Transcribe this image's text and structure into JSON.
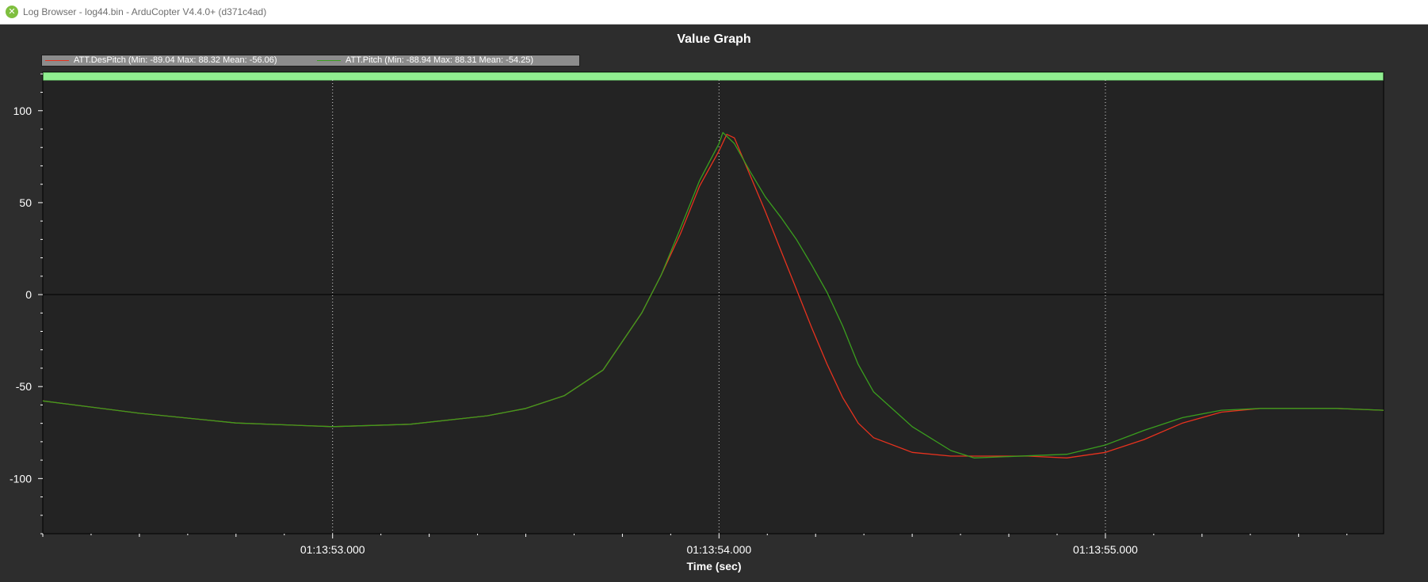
{
  "window": {
    "title": "Log Browser - log44.bin - ArduCopter V4.4.0+ (d371c4ad)"
  },
  "colors": {
    "series_despitch": "#e8321e",
    "series_pitch": "#3a9e1e",
    "plot_background": "#232323",
    "frame_background": "#2d2d2d",
    "mode_band": "#90ee90",
    "legend_background": "#8c8c8c"
  },
  "chart_data": {
    "type": "line",
    "title": "Value Graph",
    "xlabel": "Time (sec)",
    "ylabel": "",
    "x_units": "seconds (time of day)",
    "xlim": [
      "01:13:52.250",
      "01:13:55.720"
    ],
    "ylim": [
      -130,
      121
    ],
    "x_ticks": [
      "01:13:53.000",
      "01:13:54.000",
      "01:13:55.000"
    ],
    "y_ticks": [
      100,
      50,
      0,
      -50,
      -100
    ],
    "grid": "vertical dotted lines at major x ticks",
    "legend": "top-left",
    "top_band": "green bar across top of plot",
    "series": [
      {
        "name": "ATT.DesPitch",
        "legend_label": "ATT.DesPitch  (Min: -89.04 Max: 88.32 Mean: -56.06)",
        "color": "#e8321e",
        "points": [
          [
            "01:13:52.250",
            -57.8
          ],
          [
            "01:13:52.500",
            -64.5
          ],
          [
            "01:13:52.750",
            -69.8
          ],
          [
            "01:13:53.000",
            -71.8
          ],
          [
            "01:13:53.200",
            -70.5
          ],
          [
            "01:13:53.400",
            -65.9
          ],
          [
            "01:13:53.500",
            -61.9
          ],
          [
            "01:13:53.600",
            -54.9
          ],
          [
            "01:13:53.700",
            -41.0
          ],
          [
            "01:13:53.800",
            -10.0
          ],
          [
            "01:13:53.850",
            10.5
          ],
          [
            "01:13:53.900",
            33.0
          ],
          [
            "01:13:53.950",
            59.1
          ],
          [
            "01:13:54.000",
            78.1
          ],
          [
            "01:13:54.020",
            87.1
          ],
          [
            "01:13:54.040",
            85.2
          ],
          [
            "01:13:54.080",
            65.1
          ],
          [
            "01:13:54.120",
            45.2
          ],
          [
            "01:13:54.160",
            24.1
          ],
          [
            "01:13:54.200",
            3.1
          ],
          [
            "01:13:54.240",
            -18.0
          ],
          [
            "01:13:54.280",
            -37.9
          ],
          [
            "01:13:54.320",
            -55.9
          ],
          [
            "01:13:54.360",
            -69.8
          ],
          [
            "01:13:54.400",
            -77.8
          ],
          [
            "01:13:54.500",
            -85.8
          ],
          [
            "01:13:54.600",
            -87.8
          ],
          [
            "01:13:54.800",
            -87.8
          ],
          [
            "01:13:54.900",
            -88.8
          ],
          [
            "01:13:55.000",
            -85.8
          ],
          [
            "01:13:55.100",
            -78.8
          ],
          [
            "01:13:55.200",
            -69.8
          ],
          [
            "01:13:55.300",
            -63.9
          ],
          [
            "01:13:55.400",
            -61.9
          ],
          [
            "01:13:55.600",
            -61.9
          ],
          [
            "01:13:55.720",
            -62.9
          ]
        ]
      },
      {
        "name": "ATT.Pitch",
        "legend_label": "ATT.Pitch  (Min: -88.94 Max: 88.31 Mean: -54.25)",
        "color": "#3a9e1e",
        "points": [
          [
            "01:13:52.250",
            -57.8
          ],
          [
            "01:13:52.500",
            -64.5
          ],
          [
            "01:13:52.750",
            -69.8
          ],
          [
            "01:13:53.000",
            -71.8
          ],
          [
            "01:13:53.200",
            -70.5
          ],
          [
            "01:13:53.400",
            -65.9
          ],
          [
            "01:13:53.500",
            -61.9
          ],
          [
            "01:13:53.600",
            -54.9
          ],
          [
            "01:13:53.700",
            -41.0
          ],
          [
            "01:13:53.800",
            -10.0
          ],
          [
            "01:13:53.850",
            10.5
          ],
          [
            "01:13:53.900",
            36.0
          ],
          [
            "01:13:53.950",
            62.1
          ],
          [
            "01:13:54.000",
            82.1
          ],
          [
            "01:13:54.010",
            88.1
          ],
          [
            "01:13:54.040",
            82.1
          ],
          [
            "01:13:54.080",
            67.1
          ],
          [
            "01:13:54.120",
            53.1
          ],
          [
            "01:13:54.160",
            42.1
          ],
          [
            "01:13:54.200",
            30.1
          ],
          [
            "01:13:54.240",
            16.1
          ],
          [
            "01:13:54.280",
            1.1
          ],
          [
            "01:13:54.320",
            -17.0
          ],
          [
            "01:13:54.360",
            -37.9
          ],
          [
            "01:13:54.400",
            -52.9
          ],
          [
            "01:13:54.500",
            -71.8
          ],
          [
            "01:13:54.600",
            -84.8
          ],
          [
            "01:13:54.660",
            -88.8
          ],
          [
            "01:13:54.900",
            -86.8
          ],
          [
            "01:13:55.000",
            -81.8
          ],
          [
            "01:13:55.100",
            -73.8
          ],
          [
            "01:13:55.200",
            -66.9
          ],
          [
            "01:13:55.300",
            -62.9
          ],
          [
            "01:13:55.400",
            -61.9
          ],
          [
            "01:13:55.600",
            -61.9
          ],
          [
            "01:13:55.720",
            -62.9
          ]
        ]
      }
    ]
  }
}
